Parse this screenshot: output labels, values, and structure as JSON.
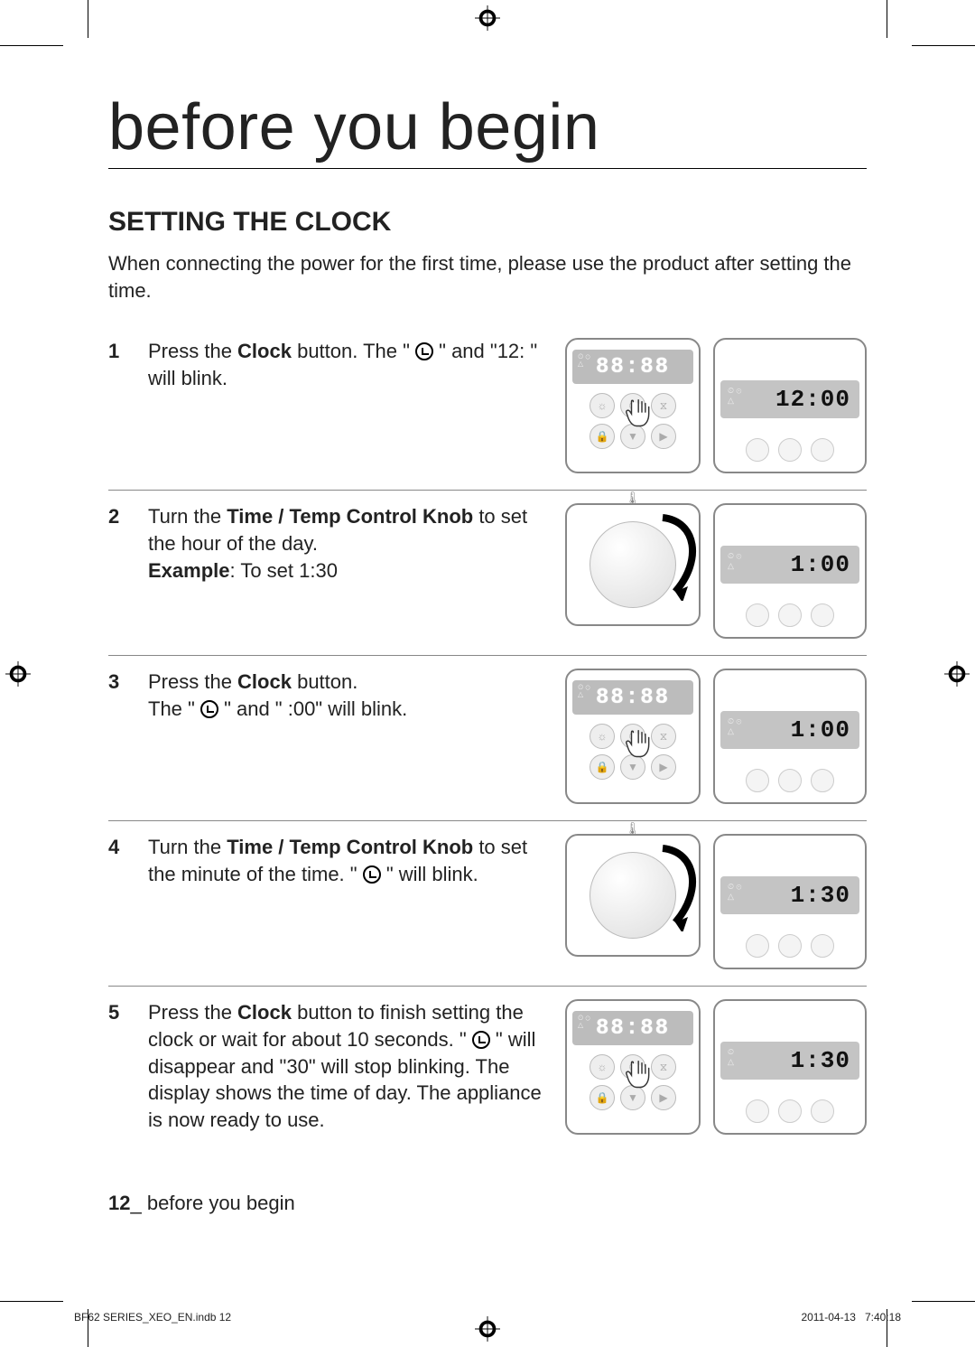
{
  "title": "before you begin",
  "section_heading": "SETTING THE CLOCK",
  "intro": "When connecting the power for the first time, please use the product after setting the time.",
  "steps": [
    {
      "num": "1",
      "text_before": "Press the ",
      "bold1": "Clock",
      "text_mid": " button. The \" ",
      "text_after": " \" and \"12: \" will blink.",
      "panel_lcd": "88:88",
      "result_lcd": "12:00",
      "type": "press"
    },
    {
      "num": "2",
      "text_before": "Turn the ",
      "bold1": "Time / Temp Control Knob",
      "text_mid": " to set the hour of the day.",
      "example_label": "Example",
      "example_text": ": To set 1:30",
      "result_lcd": "1:00",
      "type": "knob"
    },
    {
      "num": "3",
      "text_before": "Press the ",
      "bold1": "Clock",
      "text_mid": " button.",
      "line2_before": "The \" ",
      "line2_after": " \" and \" :00\" will blink.",
      "panel_lcd": "88:88",
      "result_lcd": "1:00",
      "type": "press"
    },
    {
      "num": "4",
      "text_before": "Turn the ",
      "bold1": "Time / Temp Control Knob",
      "text_mid": " to set the minute of the time. \" ",
      "text_after": " \" will blink.",
      "result_lcd": "1:30",
      "type": "knob"
    },
    {
      "num": "5",
      "text_before": "Press the ",
      "bold1": "Clock",
      "text_mid": " button to finish setting the clock or wait for about 10 seconds. \" ",
      "text_after": " \" will disappear and \"30\" will stop blinking. The display shows the time of day. The appliance is now ready to use.",
      "panel_lcd": "88:88",
      "result_lcd": "1:30",
      "type": "press"
    }
  ],
  "footer_page": "12",
  "footer_text": "_ before you begin",
  "meta_file": "BF62 SERIES_XEO_EN.indb   12",
  "meta_date": "2011-04-13",
  "meta_time": "7:40:18"
}
